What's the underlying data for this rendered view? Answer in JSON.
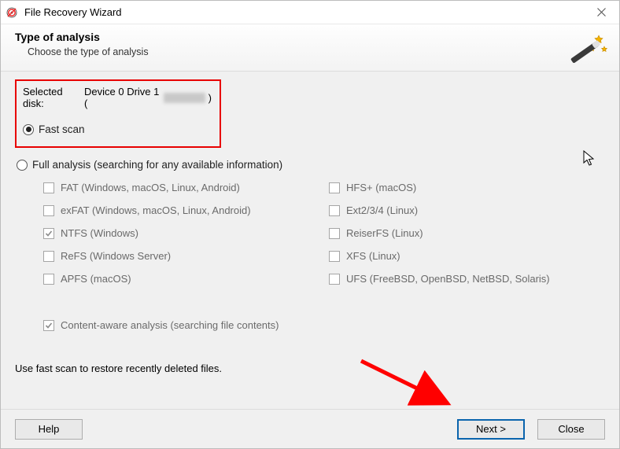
{
  "title": "File Recovery Wizard",
  "header": {
    "heading": "Type of analysis",
    "sub": "Choose the type of analysis"
  },
  "selected_disk": {
    "label_prefix": "Selected disk: ",
    "value": "Device 0 Drive 1 (",
    "suffix": ")"
  },
  "scan": {
    "fast_label": "Fast scan",
    "full_label": "Full analysis (searching for any available information)",
    "selected": "fast"
  },
  "filesystems": {
    "left": [
      {
        "label": "FAT (Windows, macOS, Linux, Android)",
        "checked": false
      },
      {
        "label": "exFAT (Windows, macOS, Linux, Android)",
        "checked": false
      },
      {
        "label": "NTFS (Windows)",
        "checked": true
      },
      {
        "label": "ReFS (Windows Server)",
        "checked": false
      },
      {
        "label": "APFS (macOS)",
        "checked": false
      }
    ],
    "right": [
      {
        "label": "HFS+ (macOS)",
        "checked": false
      },
      {
        "label": "Ext2/3/4 (Linux)",
        "checked": false
      },
      {
        "label": "ReiserFS (Linux)",
        "checked": false
      },
      {
        "label": "XFS (Linux)",
        "checked": false
      },
      {
        "label": "UFS (FreeBSD, OpenBSD, NetBSD, Solaris)",
        "checked": false
      }
    ]
  },
  "content_aware": {
    "label": "Content-aware analysis (searching file contents)",
    "checked": true
  },
  "hint": "Use fast scan to restore recently deleted files.",
  "buttons": {
    "help": "Help",
    "next": "Next >",
    "close": "Close"
  },
  "colors": {
    "highlight": "#e80000",
    "primary_border": "#0a64ad",
    "arrow": "#ff0000"
  }
}
